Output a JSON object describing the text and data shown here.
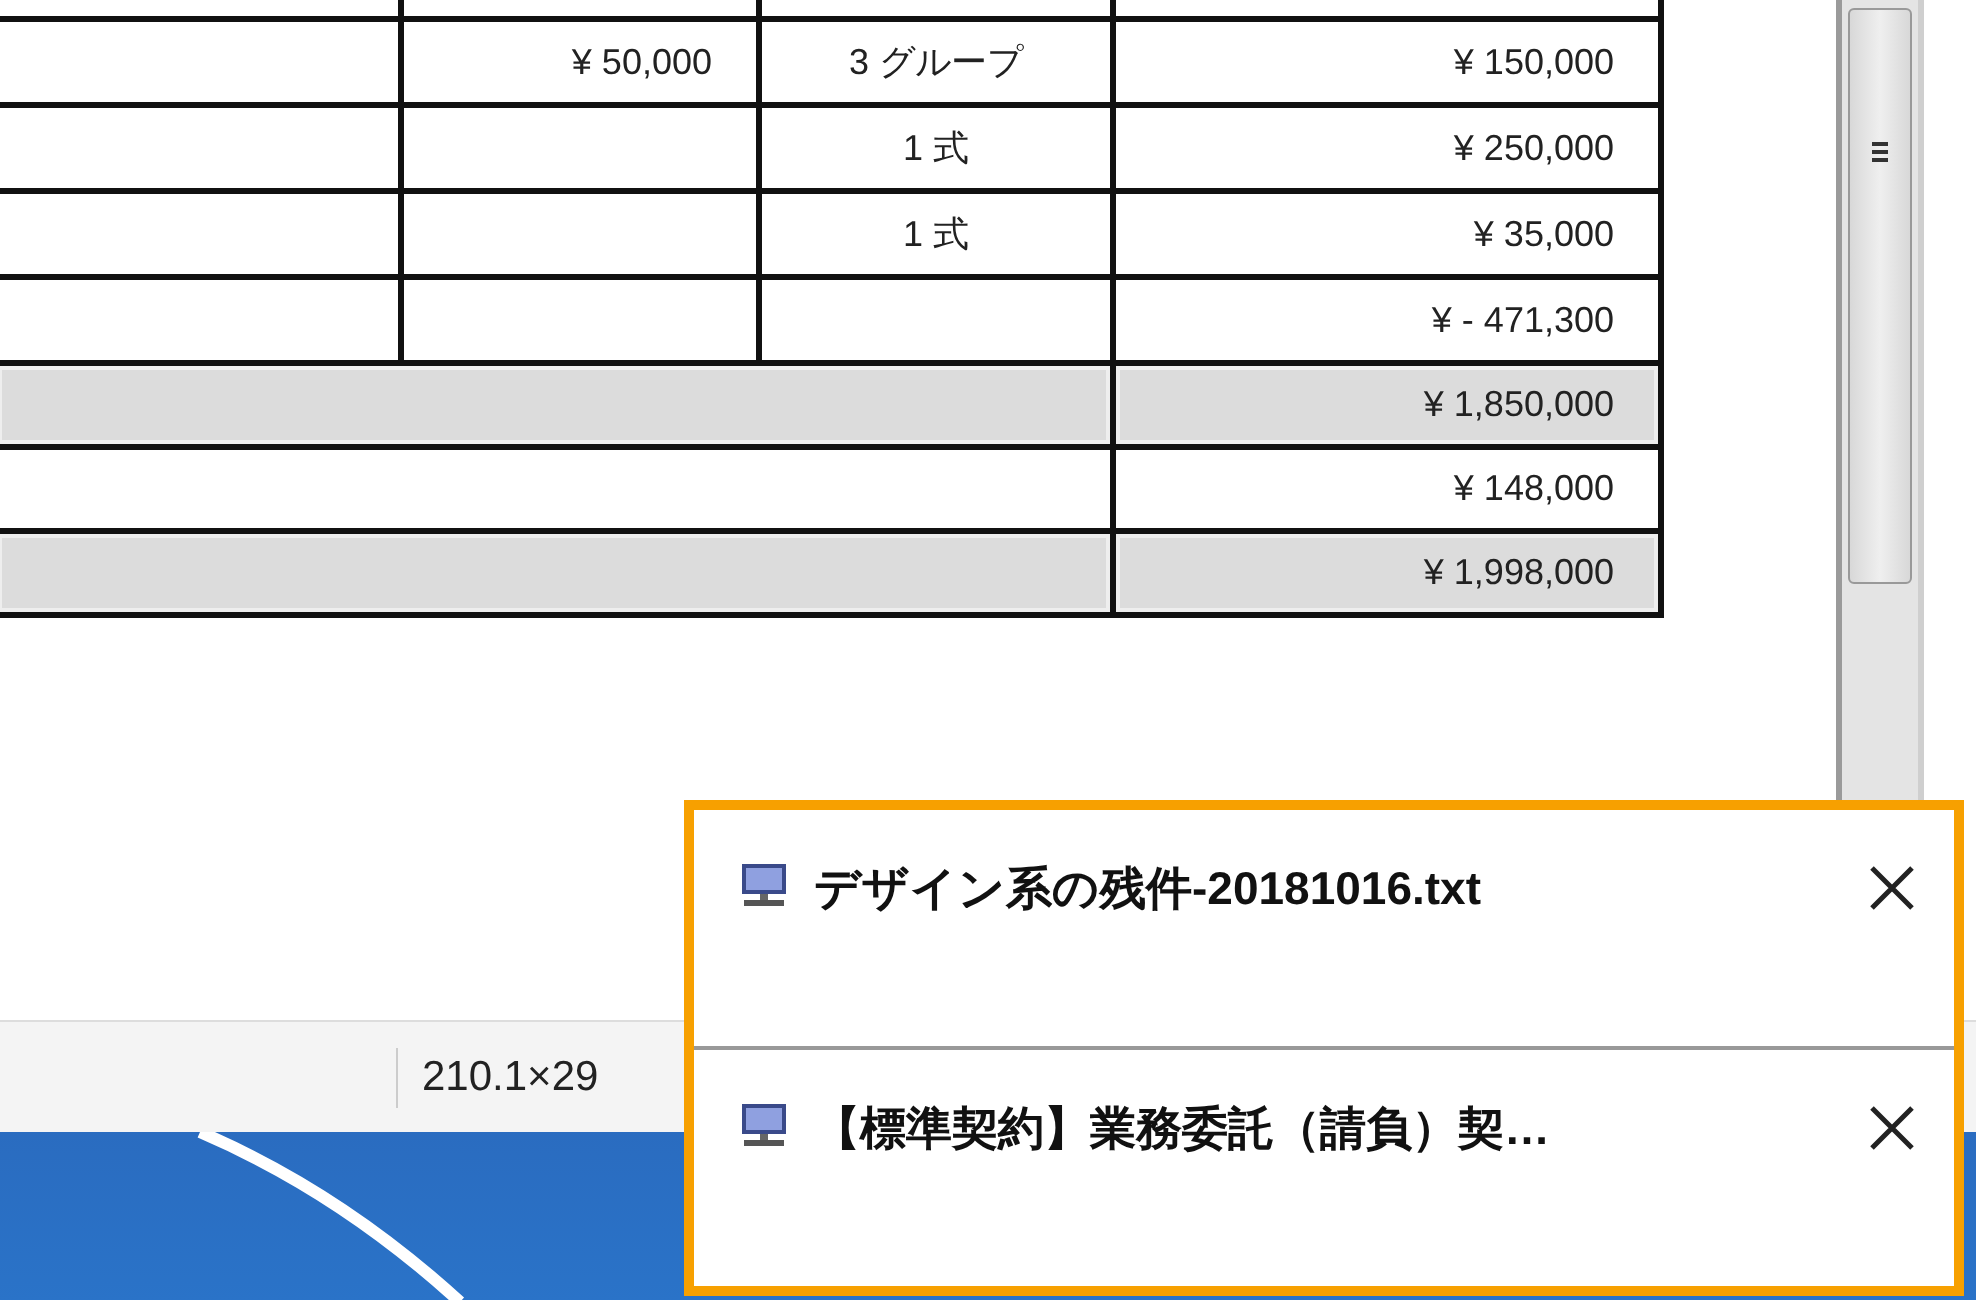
{
  "table": {
    "rows": [
      {
        "kind": "line",
        "cells": [
          "",
          "¥ 50,000",
          "3 グループ",
          "¥ 150,000"
        ]
      },
      {
        "kind": "line",
        "cells": [
          "",
          "",
          "1 式",
          "¥ 250,000"
        ]
      },
      {
        "kind": "line",
        "cells": [
          "",
          "",
          "1 式",
          "¥ 35,000"
        ]
      },
      {
        "kind": "line",
        "cells": [
          "",
          "",
          "",
          "¥ - 471,300"
        ]
      },
      {
        "kind": "summary",
        "shaded": true,
        "amount": "¥ 1,850,000"
      },
      {
        "kind": "summary",
        "shaded": false,
        "amount": "¥ 148,000"
      },
      {
        "kind": "summary",
        "shaded": true,
        "amount": "¥ 1,998,000"
      }
    ]
  },
  "status_bar": {
    "size": "210.1×29"
  },
  "notifications": [
    {
      "title": "デザイン系の残件-20181016.txt"
    },
    {
      "title": "【標準契約】業務委託（請負）契…"
    }
  ]
}
